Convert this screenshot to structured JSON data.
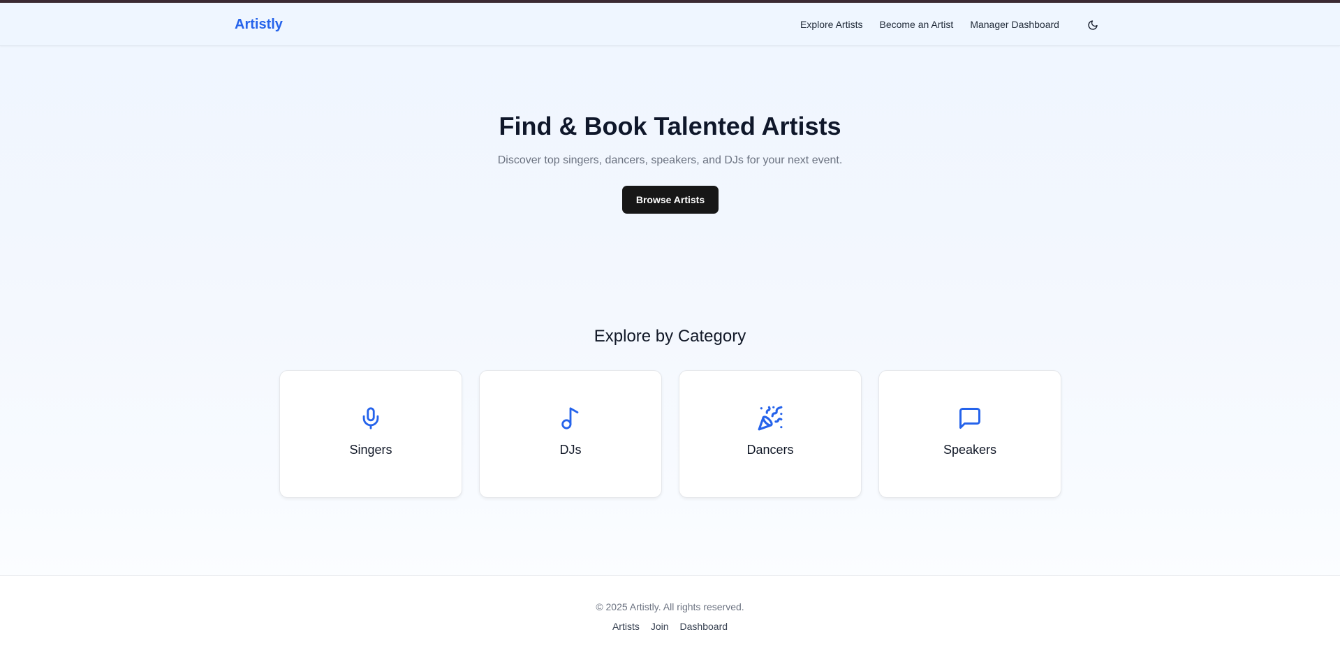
{
  "colors": {
    "brand": "#2563eb",
    "hero_bg": "#eff6ff",
    "cta_bg": "#171717",
    "top_strip": "#3b2a33"
  },
  "navbar": {
    "brand": "Artistly",
    "links": [
      {
        "label": "Explore Artists"
      },
      {
        "label": "Become an Artist"
      },
      {
        "label": "Manager Dashboard"
      }
    ],
    "theme_toggle_icon": "moon-icon"
  },
  "hero": {
    "title": "Find & Book Talented Artists",
    "subtitle": "Discover top singers, dancers, speakers, and DJs for your next event.",
    "cta_label": "Browse Artists"
  },
  "categories": {
    "title": "Explore by Category",
    "items": [
      {
        "label": "Singers",
        "icon": "microphone-icon"
      },
      {
        "label": "DJs",
        "icon": "music-note-icon"
      },
      {
        "label": "Dancers",
        "icon": "party-popper-icon"
      },
      {
        "label": "Speakers",
        "icon": "message-bubble-icon"
      }
    ]
  },
  "footer": {
    "copyright": "© 2025 Artistly. All rights reserved.",
    "links": [
      {
        "label": "Artists"
      },
      {
        "label": "Join"
      },
      {
        "label": "Dashboard"
      }
    ]
  }
}
